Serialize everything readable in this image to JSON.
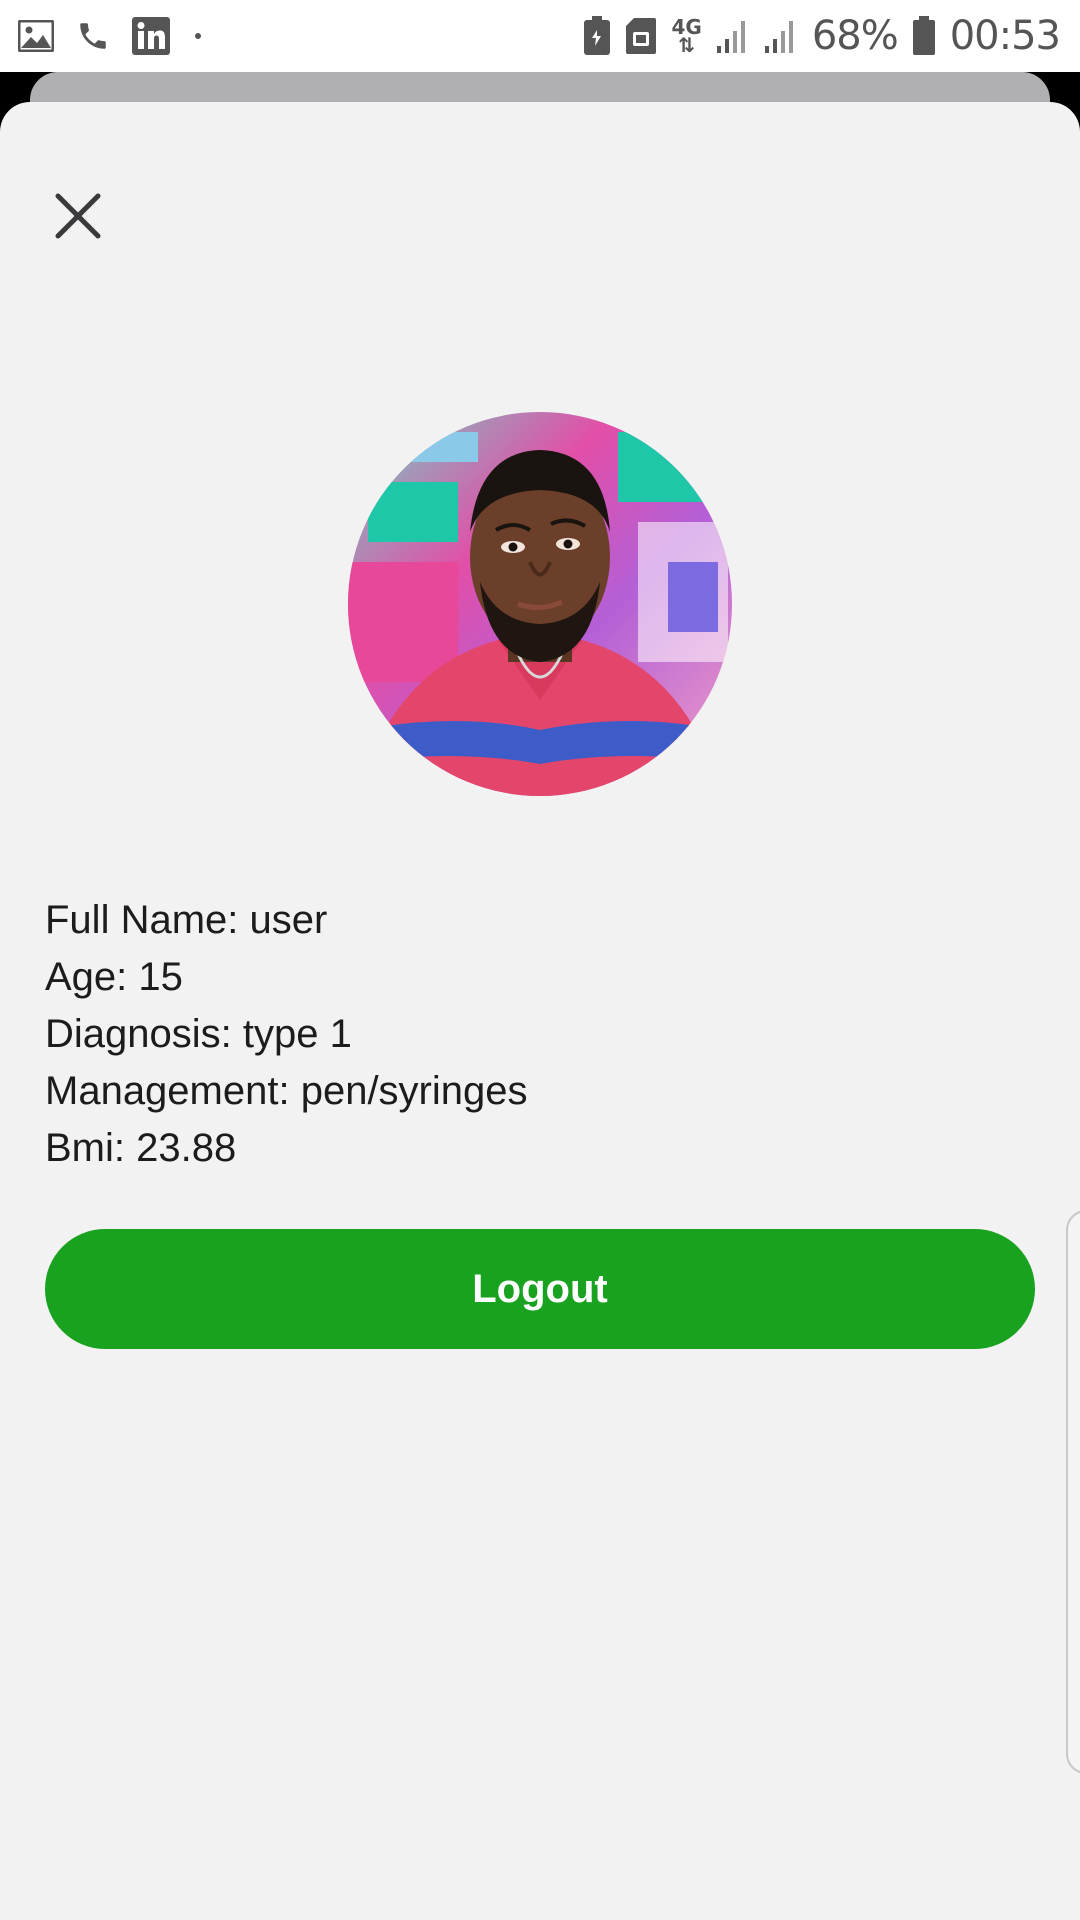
{
  "status_bar": {
    "left_icons": [
      "gallery-icon",
      "phone-icon",
      "linkedin-icon",
      "dot-icon"
    ],
    "right_icons": [
      "battery-saver-icon",
      "sim-card-icon",
      "data-4g-icon",
      "signal-icon",
      "signal-icon"
    ],
    "network_label": "4G",
    "battery_percent": "68%",
    "time": "00:53"
  },
  "modal": {
    "close_icon": "close-icon",
    "avatar_alt": "user avatar photo"
  },
  "profile": {
    "full_name": "Full Name: user",
    "age": "Age: 15",
    "diagnosis": "Diagnosis: type 1",
    "management": "Management: pen/syringes",
    "bmi": "Bmi: 23.88"
  },
  "actions": {
    "logout_label": "Logout"
  },
  "colors": {
    "accent": "#18a21f",
    "sheet_background": "#f2f2f2",
    "text": "#1c1c1e"
  }
}
